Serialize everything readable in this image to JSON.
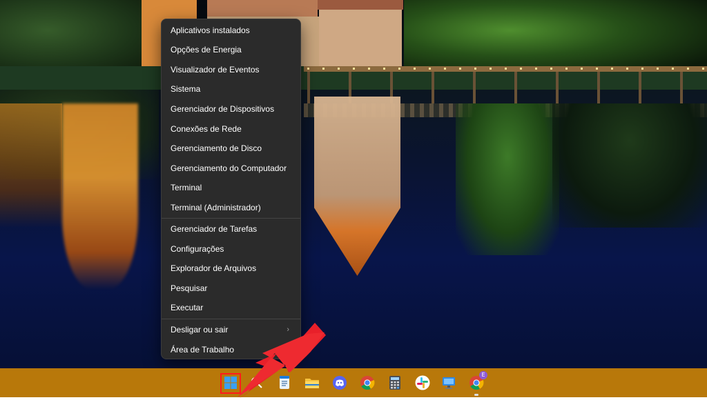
{
  "context_menu": {
    "items": [
      {
        "label": "Aplicativos instalados"
      },
      {
        "label": "Opções de Energia"
      },
      {
        "label": "Visualizador de Eventos"
      },
      {
        "label": "Sistema"
      },
      {
        "label": "Gerenciador de Dispositivos"
      },
      {
        "label": "Conexões de Rede"
      },
      {
        "label": "Gerenciamento de Disco"
      },
      {
        "label": "Gerenciamento do Computador"
      },
      {
        "label": "Terminal"
      },
      {
        "label": "Terminal (Administrador)"
      },
      {
        "label": "Gerenciador de Tarefas"
      },
      {
        "label": "Configurações"
      },
      {
        "label": "Explorador de Arquivos"
      },
      {
        "label": "Pesquisar"
      },
      {
        "label": "Executar"
      },
      {
        "label": "Desligar ou sair",
        "submenu_icon": "chevron-right-icon"
      },
      {
        "label": "Área de Trabalho"
      }
    ]
  },
  "taskbar": {
    "icons": [
      {
        "name": "start-button",
        "icon": "windows-logo-icon",
        "highlighted": true
      },
      {
        "name": "search",
        "icon": "search-icon"
      },
      {
        "name": "notepad",
        "icon": "notepad-icon"
      },
      {
        "name": "file-explorer",
        "icon": "folder-icon"
      },
      {
        "name": "discord",
        "icon": "discord-icon"
      },
      {
        "name": "chrome",
        "icon": "chrome-icon"
      },
      {
        "name": "calculator",
        "icon": "calculator-icon"
      },
      {
        "name": "slack",
        "icon": "slack-icon"
      },
      {
        "name": "remote-desktop",
        "icon": "monitor-icon"
      },
      {
        "name": "chrome-profile",
        "icon": "chrome-icon",
        "badge": "E",
        "running": true
      }
    ]
  },
  "colors": {
    "taskbar": "#b8780a",
    "menu_background": "#2b2b2b",
    "annotation_red": "#ff1b1b"
  }
}
